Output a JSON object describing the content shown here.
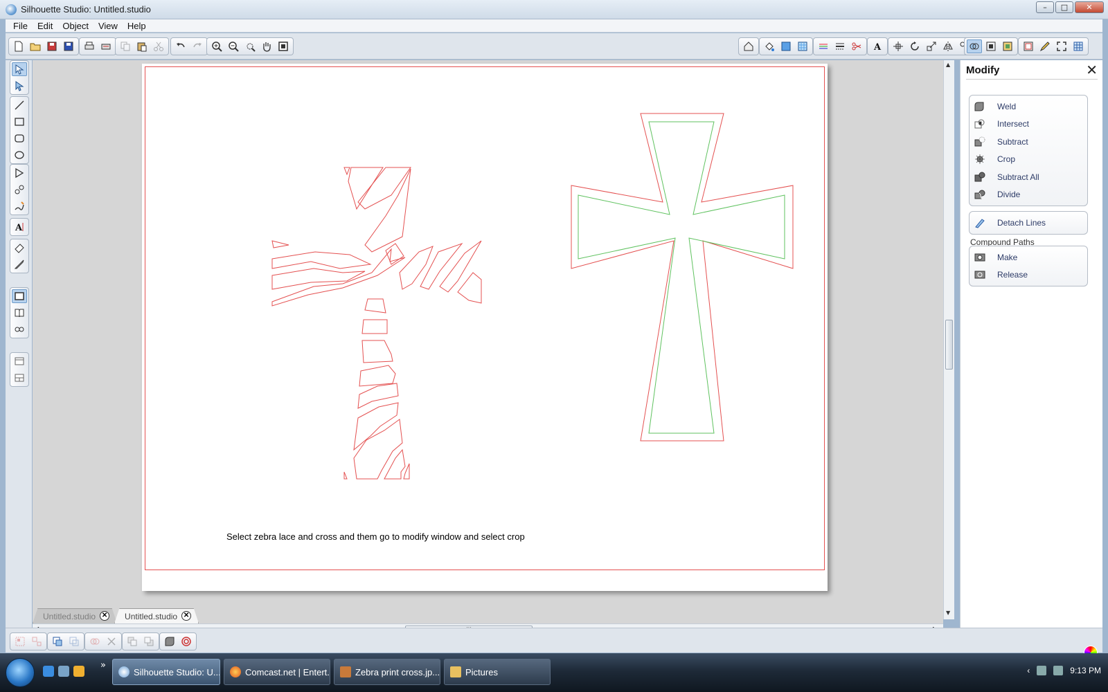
{
  "window": {
    "title": "Silhouette Studio: Untitled.studio",
    "min": "–",
    "max": "□",
    "close": "✕"
  },
  "menu": [
    "File",
    "Edit",
    "Object",
    "View",
    "Help"
  ],
  "instruction": "Select zebra lace and cross and them go to modify window and select crop",
  "tabs": [
    {
      "label": "Untitled.studio",
      "active": false
    },
    {
      "label": "Untitled.studio",
      "active": true
    }
  ],
  "modify": {
    "title": "Modify",
    "ops": [
      "Weld",
      "Intersect",
      "Subtract",
      "Crop",
      "Subtract All",
      "Divide"
    ],
    "detach": "Detach Lines",
    "compound_label": "Compound Paths",
    "compound": [
      "Make",
      "Release"
    ]
  },
  "taskbar": {
    "items": [
      {
        "label": "Silhouette Studio: U...",
        "active": true
      },
      {
        "label": "Comcast.net | Entert...",
        "active": false
      },
      {
        "label": "Zebra print cross.jp...",
        "active": false
      },
      {
        "label": "Pictures",
        "active": false
      }
    ],
    "clock": "9:13 PM",
    "overflow": "»",
    "tray_arrow": "‹"
  },
  "colors": {
    "cut_line": "#e45050",
    "offset_line": "#5fc25f",
    "accent": "#6e9bc9"
  }
}
